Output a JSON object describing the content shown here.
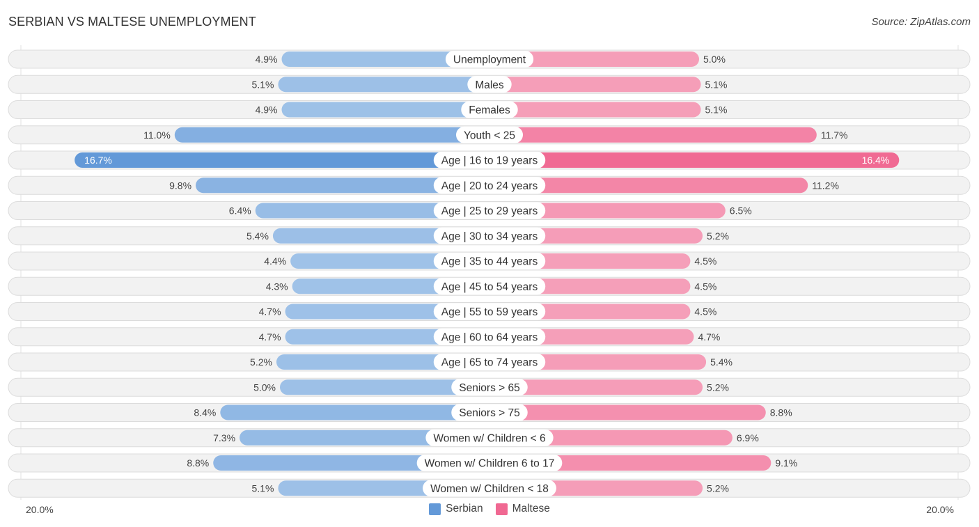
{
  "header": {
    "title": "SERBIAN VS MALTESE UNEMPLOYMENT",
    "source": "Source: ZipAtlas.com"
  },
  "colors": {
    "serbian_strong": "#6399d8",
    "serbian_light": "#a7c7ea",
    "maltese_strong": "#f06892",
    "maltese_light": "#f6a7bf"
  },
  "chart_data": {
    "type": "bar",
    "orientation": "horizontal-diverging",
    "title": "SERBIAN VS MALTESE UNEMPLOYMENT",
    "xlabel": "",
    "ylabel": "",
    "xlim": [
      0,
      20.0
    ],
    "axis_labels": {
      "left": "20.0%",
      "right": "20.0%"
    },
    "legend_position": "bottom-center",
    "categories": [
      "Unemployment",
      "Males",
      "Females",
      "Youth < 25",
      "Age | 16 to 19 years",
      "Age | 20 to 24 years",
      "Age | 25 to 29 years",
      "Age | 30 to 34 years",
      "Age | 35 to 44 years",
      "Age | 45 to 54 years",
      "Age | 55 to 59 years",
      "Age | 60 to 64 years",
      "Age | 65 to 74 years",
      "Seniors > 65",
      "Seniors > 75",
      "Women w/ Children < 6",
      "Women w/ Children 6 to 17",
      "Women w/ Children < 18"
    ],
    "series": [
      {
        "name": "Serbian",
        "side": "left",
        "values": [
          4.9,
          5.1,
          4.9,
          11.0,
          16.7,
          9.8,
          6.4,
          5.4,
          4.4,
          4.3,
          4.7,
          4.7,
          5.2,
          5.0,
          8.4,
          7.3,
          8.8,
          5.1
        ],
        "labels": [
          "4.9%",
          "5.1%",
          "4.9%",
          "11.0%",
          "16.7%",
          "9.8%",
          "6.4%",
          "5.4%",
          "4.4%",
          "4.3%",
          "4.7%",
          "4.7%",
          "5.2%",
          "5.0%",
          "8.4%",
          "7.3%",
          "8.8%",
          "5.1%"
        ]
      },
      {
        "name": "Maltese",
        "side": "right",
        "values": [
          5.0,
          5.1,
          5.1,
          11.7,
          16.4,
          11.2,
          6.5,
          5.2,
          4.5,
          4.5,
          4.5,
          4.7,
          5.4,
          5.2,
          8.8,
          6.9,
          9.1,
          5.2
        ],
        "labels": [
          "5.0%",
          "5.1%",
          "5.1%",
          "11.7%",
          "16.4%",
          "11.2%",
          "6.5%",
          "5.2%",
          "4.5%",
          "4.5%",
          "4.5%",
          "4.7%",
          "5.4%",
          "5.2%",
          "8.8%",
          "6.9%",
          "9.1%",
          "5.2%"
        ]
      }
    ],
    "legend": [
      "Serbian",
      "Maltese"
    ]
  }
}
